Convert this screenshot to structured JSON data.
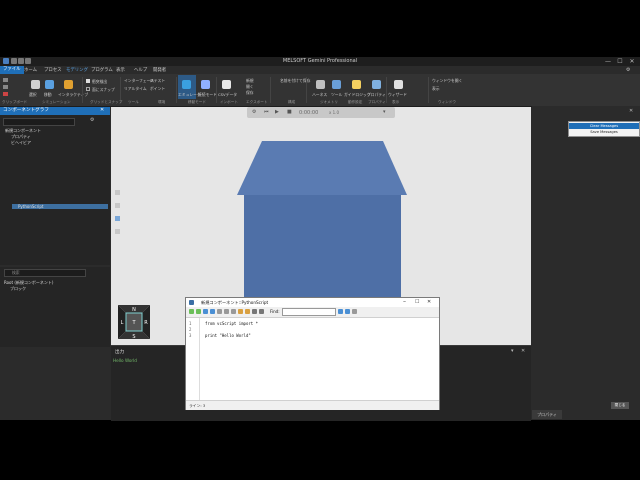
{
  "app": {
    "title": "MELSOFT Gemini Professional"
  },
  "window_controls": {
    "minimize": "—",
    "maximize": "☐",
    "close": "✕"
  },
  "menu": [
    {
      "label": "ファイル",
      "active": true
    },
    {
      "label": "ホーム"
    },
    {
      "label": "プロセス"
    },
    {
      "label": "モデリング"
    },
    {
      "label": "プログラム"
    },
    {
      "label": "表示"
    },
    {
      "label": "ヘルプ"
    },
    {
      "label": "開発者"
    }
  ],
  "ribbon": {
    "buttons": [
      {
        "label": "選択",
        "icon": "cursor-icon",
        "color": "#d0d0d0"
      },
      {
        "label": "移動",
        "icon": "move-icon",
        "color": "#5aa0e0"
      },
      {
        "label": "インタラクティブ",
        "icon": "interactive-icon",
        "color": "#e0a030"
      },
      {
        "label": "シミュレーション",
        "icon": "sim-icon",
        "color": "#c0c0c0"
      },
      {
        "label": "ロボットパス",
        "icon": "robot-path-icon",
        "color": "#f0c040"
      },
      {
        "label": "エミュレータ",
        "icon": "emulator-icon",
        "color": "#3aa0e0"
      },
      {
        "label": "接続モード",
        "icon": "connect-icon",
        "color": "#90b0ff"
      },
      {
        "label": "CSVデータ",
        "icon": "csv-icon",
        "color": "#e8e8e8"
      },
      {
        "label": "ハーネス",
        "icon": "harness-icon",
        "color": "#c0c0c0"
      },
      {
        "label": "ツール",
        "icon": "tools-icon",
        "color": "#6a9fd8"
      },
      {
        "label": "ガイドロジック",
        "icon": "guide-icon",
        "color": "#f5d060"
      },
      {
        "label": "動作設定",
        "icon": "motion-icon",
        "color": "#cfcfcf"
      },
      {
        "label": "プロパティ",
        "icon": "property-icon",
        "color": "#7fb0e0"
      },
      {
        "label": "ウィザード",
        "icon": "wizard-icon",
        "color": "#e0e0e0"
      }
    ],
    "small_items": [
      "インターフェース",
      "リアルタイム",
      "IRテスト",
      "ボイント",
      "新規",
      "開く",
      "保存",
      "名前を付けて保存",
      "ウィンドウを開く",
      "表示"
    ],
    "groups": [
      "クリップボード",
      "シミュレーション",
      "グリッドとスナップ",
      "ツール",
      "環境",
      "移動モード",
      "インポート",
      "エクスポート",
      "構成",
      "ジオメトリ",
      "動作設定",
      "プロパティ",
      "表示",
      "ウィンドウ"
    ],
    "checkboxes": [
      {
        "label": "衝突検出",
        "checked": true
      },
      {
        "label": "面にスナップ",
        "checked": false
      }
    ]
  },
  "component_tree": {
    "title": "コンポーネントグラフ",
    "items": [
      {
        "label": "新規コンポーネント",
        "indent": 0
      },
      {
        "label": "プロパティ",
        "indent": 1
      },
      {
        "label": "ビヘイビア",
        "indent": 1
      },
      {
        "label": "PythonScript",
        "indent": 2,
        "selected": true
      }
    ]
  },
  "lower_panel": {
    "search_placeholder": "検索",
    "items": [
      {
        "label": "Root (新規コンポーネント)",
        "indent": 0
      },
      {
        "label": "ブロック",
        "indent": 1
      }
    ]
  },
  "view_toolbar": {
    "time": "0:00:00",
    "speed": "x 1.0"
  },
  "navcube": {
    "top": "N",
    "left": "L",
    "center": "T",
    "right": "R",
    "bottom": "S"
  },
  "output": {
    "title": "出力",
    "lines": [
      "Hello World"
    ]
  },
  "editor": {
    "title": "新規コンポーネント::PythonScript",
    "find_label": "Find:",
    "find_value": "",
    "line_numbers": [
      "1",
      "2",
      "3"
    ],
    "code_lines": [
      "from vcScript import *",
      "",
      "print \"Hello World\""
    ],
    "status": "ライン: 3"
  },
  "right_panel": {
    "context_menu": [
      "Clear Messages",
      "Save Messages"
    ],
    "highlighted_index": 0,
    "close_button": "閉じる",
    "tab_label": "プロパティ"
  },
  "colors": {
    "accent": "#1f6fb8",
    "cube": "#4e6fa6",
    "output_text": "#73b86a"
  }
}
